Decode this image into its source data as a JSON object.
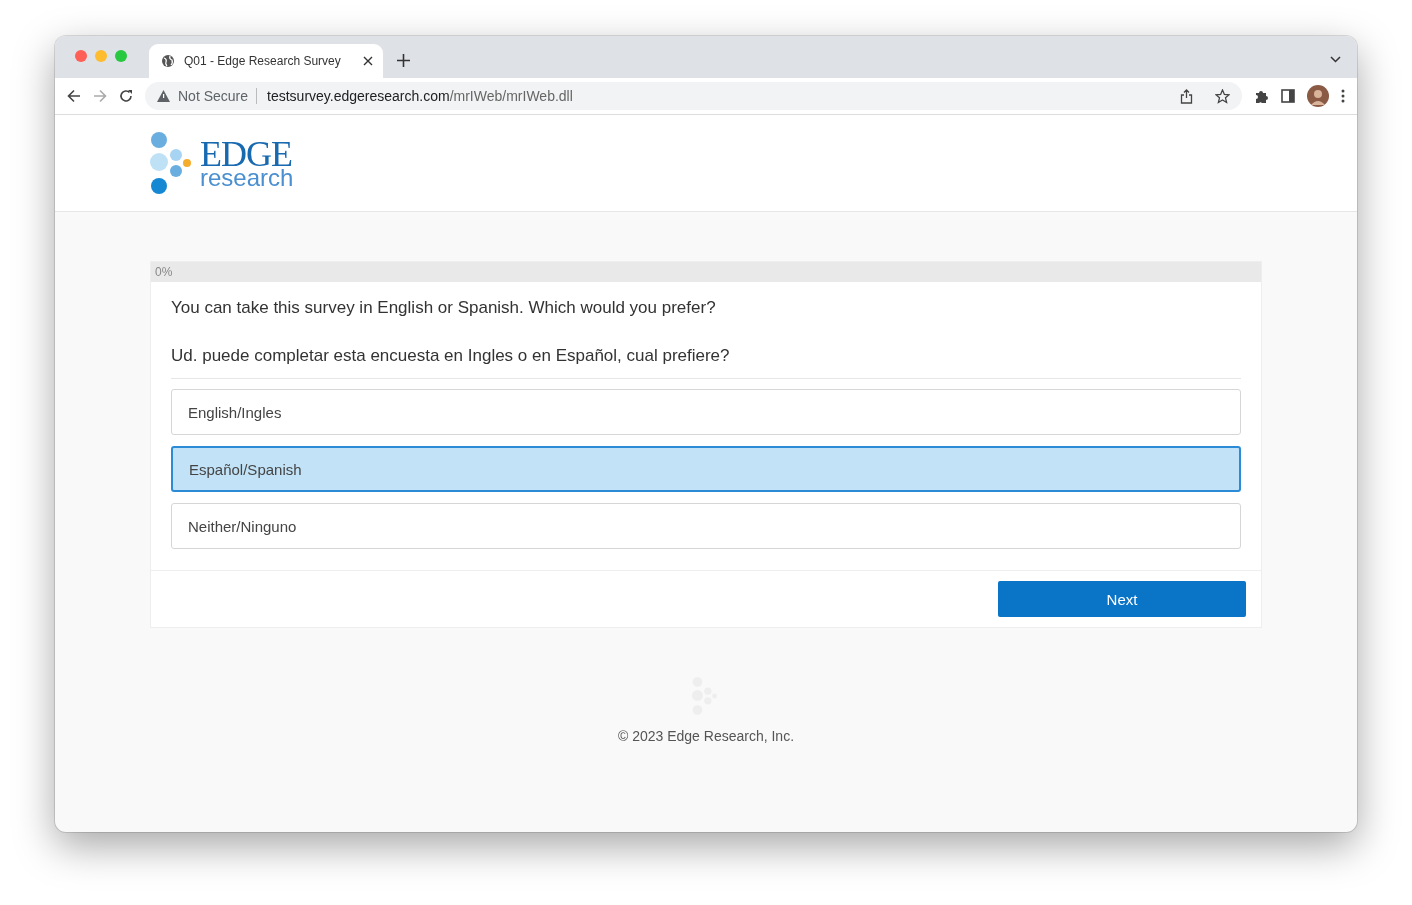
{
  "browser": {
    "tab_title": "Q01 - Edge Research Survey",
    "security": "Not Secure",
    "url_host": "testsurvey.edgeresearch.com",
    "url_path": "/mrIWeb/mrIWeb.dll"
  },
  "logo": {
    "word": "EDGE",
    "subword": "research"
  },
  "progress": {
    "label": "0%",
    "level": 0
  },
  "question": {
    "prompts": [
      "You can take this survey in English or Spanish. Which would you prefer?",
      "Ud. puede completar esta encuesta en Ingles o en Español, cual prefiere?"
    ],
    "options": [
      {
        "label": "English/Ingles",
        "selected": false
      },
      {
        "label": "Español/Spanish",
        "selected": true
      },
      {
        "label": "Neither/Ninguno",
        "selected": false
      }
    ]
  },
  "next_button": "Next",
  "footer": "© 2023 Edge Research, Inc."
}
